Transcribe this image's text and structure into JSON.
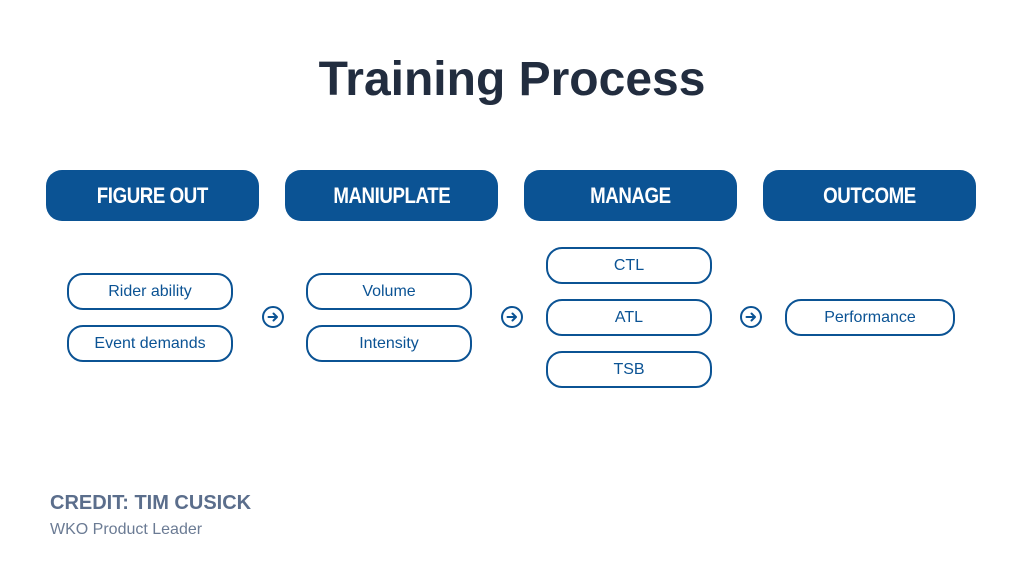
{
  "title": "Training Process",
  "columns": [
    {
      "header": "FIGURE OUT",
      "items": [
        "Rider ability",
        "Event demands"
      ]
    },
    {
      "header": "MANIUPLATE",
      "items": [
        "Volume",
        "Intensity"
      ]
    },
    {
      "header": "MANAGE",
      "items": [
        "CTL",
        "ATL",
        "TSB"
      ]
    },
    {
      "header": "OUTCOME",
      "items": [
        "Performance"
      ]
    }
  ],
  "arrows": [
    "arrow-right-circle-icon",
    "arrow-right-circle-icon",
    "arrow-right-circle-icon"
  ],
  "credit": {
    "name": "CREDIT: TIM CUSICK",
    "role": "WKO Product Leader"
  },
  "colors": {
    "primary": "#0b5394",
    "title": "#222d3f",
    "credit": "#5b6e8c"
  }
}
